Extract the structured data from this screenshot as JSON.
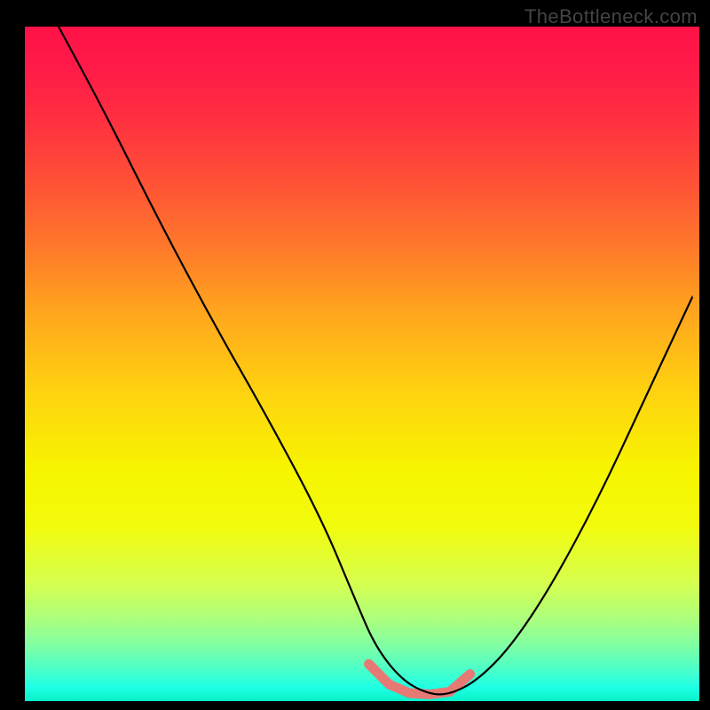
{
  "watermark": "TheBottleneck.com",
  "chart_data": {
    "type": "line",
    "title": "",
    "xlabel": "",
    "ylabel": "",
    "xlim": [
      0,
      100
    ],
    "ylim": [
      0,
      100
    ],
    "series": [
      {
        "name": "bottleneck-curve",
        "x": [
          5,
          12,
          20,
          28,
          36,
          44,
          49,
          52,
          56,
          60,
          63,
          67,
          72,
          78,
          85,
          92,
          99
        ],
        "values": [
          100,
          87,
          71,
          56,
          42,
          27,
          15,
          8,
          3,
          1,
          1,
          3,
          8,
          17,
          30,
          45,
          60
        ]
      }
    ],
    "marker": {
      "name": "optimal-range",
      "x": [
        51,
        54,
        57,
        60,
        63,
        66
      ],
      "values": [
        5.5,
        2.5,
        1.2,
        1.0,
        1.4,
        4.0
      ]
    },
    "background_gradient": {
      "top_color": "#ff1247",
      "mid_color": "#ffd210",
      "bottom_color": "#07f2c7"
    }
  }
}
